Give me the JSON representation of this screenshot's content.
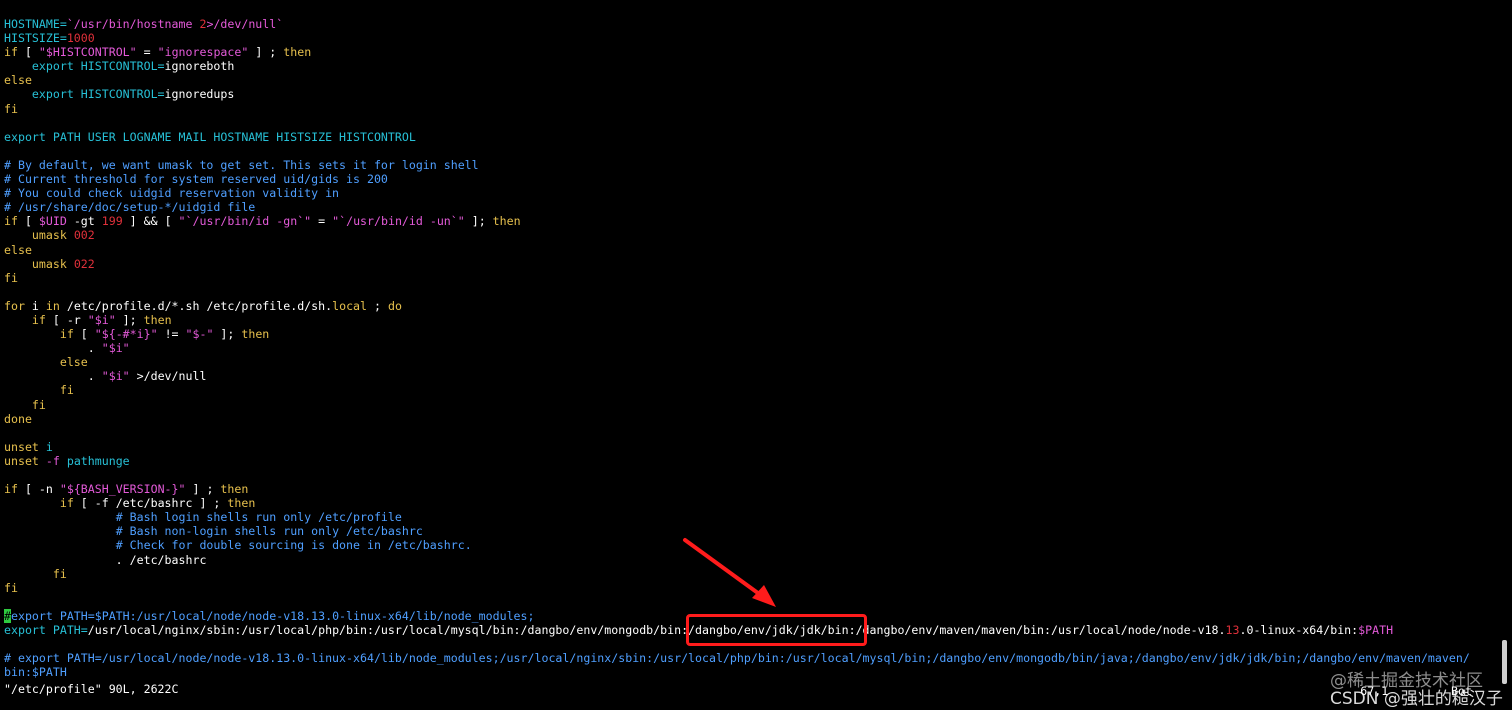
{
  "editor": {
    "status_line": "\"/etc/profile\" 90L, 2622C",
    "cursor_pos": "67,1",
    "scroll_pos": "Bot"
  },
  "watermark": {
    "line1": "@稀土掘金技术社区",
    "line2": "CSDN @强壮的糙汉子"
  },
  "code": {
    "l1": [
      [
        "cy",
        "HOSTNAME="
      ],
      [
        "var",
        "`/usr/bin/hostname "
      ],
      [
        "num",
        "2"
      ],
      [
        "var",
        ">/dev/null`"
      ]
    ],
    "l2": [
      [
        "cy",
        "HISTSIZE="
      ],
      [
        "num",
        "1000"
      ]
    ],
    "l3": [
      [
        "kw",
        "if"
      ],
      [
        "wh",
        " [ "
      ],
      [
        "var",
        "\"$HISTCONTROL\""
      ],
      [
        "wh",
        " = "
      ],
      [
        "var",
        "\"ignorespace\""
      ],
      [
        "wh",
        " ] ; "
      ],
      [
        "kw",
        "then"
      ]
    ],
    "l4": [
      [
        "wh",
        "    "
      ],
      [
        "cy",
        "export HISTCONTROL="
      ],
      [
        "wh",
        "ignoreboth"
      ]
    ],
    "l5": [
      [
        "kw",
        "else"
      ]
    ],
    "l6": [
      [
        "wh",
        "    "
      ],
      [
        "cy",
        "export HISTCONTROL="
      ],
      [
        "wh",
        "ignoredups"
      ]
    ],
    "l7": [
      [
        "kw",
        "fi"
      ]
    ],
    "l8": [],
    "l9": [
      [
        "cy",
        "export PATH USER LOGNAME MAIL HOSTNAME HISTSIZE HISTCONTROL"
      ]
    ],
    "l10": [],
    "l11": [
      [
        "cmt",
        "# By default, we want umask to get set. This sets it for login shell"
      ]
    ],
    "l12": [
      [
        "cmt",
        "# Current threshold for system reserved uid/gids is 200"
      ]
    ],
    "l13": [
      [
        "cmt",
        "# You could check uidgid reservation validity in"
      ]
    ],
    "l14": [
      [
        "cmt",
        "# /usr/share/doc/setup-*/uidgid file"
      ]
    ],
    "l15": [
      [
        "kw",
        "if"
      ],
      [
        "wh",
        " [ "
      ],
      [
        "var",
        "$UID"
      ],
      [
        "wh",
        " -gt "
      ],
      [
        "num",
        "199"
      ],
      [
        "wh",
        " ] && [ "
      ],
      [
        "var",
        "\"`/usr/bin/id -gn`\""
      ],
      [
        "wh",
        " = "
      ],
      [
        "var",
        "\"`/usr/bin/id -un`\""
      ],
      [
        "wh",
        " ]; "
      ],
      [
        "kw",
        "then"
      ]
    ],
    "l16": [
      [
        "wh",
        "    "
      ],
      [
        "kw",
        "umask"
      ],
      [
        "wh",
        " "
      ],
      [
        "num",
        "002"
      ]
    ],
    "l17": [
      [
        "kw",
        "else"
      ]
    ],
    "l18": [
      [
        "wh",
        "    "
      ],
      [
        "kw",
        "umask"
      ],
      [
        "wh",
        " "
      ],
      [
        "num",
        "022"
      ]
    ],
    "l19": [
      [
        "kw",
        "fi"
      ]
    ],
    "l20": [],
    "l21": [
      [
        "kw",
        "for"
      ],
      [
        "wh",
        " i "
      ],
      [
        "kw",
        "in"
      ],
      [
        "wh",
        " /etc/profile.d/*.sh /etc/profile.d/sh."
      ],
      [
        "kw",
        "local"
      ],
      [
        "wh",
        " ; "
      ],
      [
        "kw",
        "do"
      ]
    ],
    "l22": [
      [
        "wh",
        "    "
      ],
      [
        "kw",
        "if"
      ],
      [
        "wh",
        " [ -r "
      ],
      [
        "var",
        "\"$i\""
      ],
      [
        "wh",
        " ]; "
      ],
      [
        "kw",
        "then"
      ]
    ],
    "l23": [
      [
        "wh",
        "        "
      ],
      [
        "kw",
        "if"
      ],
      [
        "wh",
        " [ "
      ],
      [
        "var",
        "\"${-#*i}\""
      ],
      [
        "wh",
        " != "
      ],
      [
        "var",
        "\"$-\""
      ],
      [
        "wh",
        " ]; "
      ],
      [
        "kw",
        "then"
      ]
    ],
    "l24": [
      [
        "wh",
        "            . "
      ],
      [
        "var",
        "\"$i\""
      ]
    ],
    "l25": [
      [
        "wh",
        "        "
      ],
      [
        "kw",
        "else"
      ]
    ],
    "l26": [
      [
        "wh",
        "            . "
      ],
      [
        "var",
        "\"$i\""
      ],
      [
        "wh",
        " >/dev/null"
      ]
    ],
    "l27": [
      [
        "wh",
        "        "
      ],
      [
        "kw",
        "fi"
      ]
    ],
    "l28": [
      [
        "wh",
        "    "
      ],
      [
        "kw",
        "fi"
      ]
    ],
    "l29": [
      [
        "kw",
        "done"
      ]
    ],
    "l30": [],
    "l31": [
      [
        "kw",
        "unset"
      ],
      [
        "wh",
        " "
      ],
      [
        "cy",
        "i"
      ]
    ],
    "l32": [
      [
        "kw",
        "unset"
      ],
      [
        "wh",
        " "
      ],
      [
        "var",
        "-f"
      ],
      [
        "wh",
        " "
      ],
      [
        "cy",
        "pathmunge"
      ]
    ],
    "l33": [],
    "l34": [
      [
        "kw",
        "if"
      ],
      [
        "wh",
        " [ -n "
      ],
      [
        "var",
        "\"${BASH_VERSION-}\""
      ],
      [
        "wh",
        " ] ; "
      ],
      [
        "kw",
        "then"
      ]
    ],
    "l35": [
      [
        "wh",
        "        "
      ],
      [
        "kw",
        "if"
      ],
      [
        "wh",
        " [ -f /etc/bashrc ] ; "
      ],
      [
        "kw",
        "then"
      ]
    ],
    "l36": [
      [
        "wh",
        "                "
      ],
      [
        "cmt",
        "# Bash login shells run only /etc/profile"
      ]
    ],
    "l37": [
      [
        "wh",
        "                "
      ],
      [
        "cmt",
        "# Bash non-login shells run only /etc/bashrc"
      ]
    ],
    "l38": [
      [
        "wh",
        "                "
      ],
      [
        "cmt",
        "# Check for double sourcing is done in /etc/bashrc."
      ]
    ],
    "l39": [
      [
        "wh",
        "                . /etc/bashrc"
      ]
    ],
    "l40": [
      [
        "wh",
        "       "
      ],
      [
        "kw",
        "fi"
      ]
    ],
    "l41": [
      [
        "kw",
        "fi"
      ]
    ],
    "l42": [],
    "l43": [
      [
        "cursor",
        "#"
      ],
      [
        "cmt",
        "export PATH=$PATH:/usr/local/node/node-v18.13.0-linux-x64/lib/node_modules;"
      ]
    ],
    "l44": [
      [
        "cy",
        "export PATH="
      ],
      [
        "wh",
        "/usr/local/nginx/sbin:/usr/local/php/bin:/usr/local/mysql/bin:/dangbo/env/mongodb/bin:/dangbo/env/jdk/jdk/bin:/dangbo/env/maven/maven/bin:/usr/local/node/node-v18."
      ],
      [
        "num",
        "13"
      ],
      [
        "wh",
        ".0-linux-x64/bin:"
      ],
      [
        "var",
        "$PATH"
      ]
    ],
    "l45": [],
    "l46": [
      [
        "cmt",
        "# export PATH=/usr/local/node/node-v18.13.0-linux-x64/lib/node_modules;/usr/local/nginx/sbin:/usr/local/php/bin:/usr/local/mysql/bin;/dangbo/env/mongodb/bin/java;/dangbo/env/jdk/jdk/bin;/dangbo/env/maven/maven/"
      ]
    ],
    "l47": [
      [
        "cmt",
        "bin:$PATH"
      ]
    ]
  }
}
